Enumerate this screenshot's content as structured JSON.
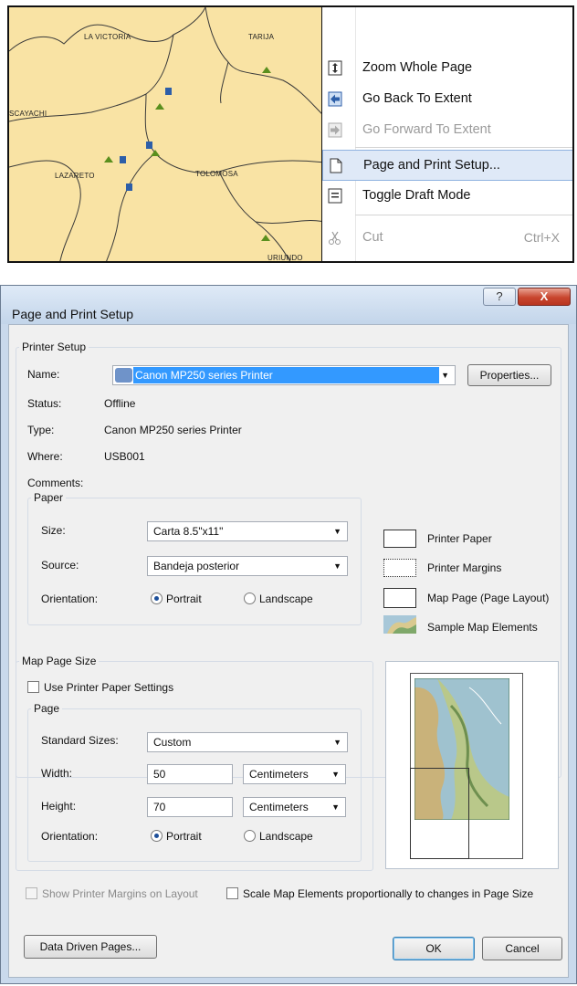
{
  "map": {
    "places": [
      "LA VICTORIA",
      "TARIJA",
      "SCAYACHI",
      "LAZARETO",
      "TOLOMOSA",
      "URIUNDO"
    ],
    "background_color": "#f9e3a4",
    "road_color": "#3a3a3a"
  },
  "context_menu": {
    "items": [
      {
        "label": "Zoom Whole Page",
        "icon": "zoom-whole-page-icon"
      },
      {
        "label": "Go Back To Extent",
        "icon": "go-back-extent-icon"
      },
      {
        "label": "Go Forward To Extent",
        "icon": "go-forward-extent-icon"
      },
      {
        "label": "Page and Print Setup...",
        "icon": "page-print-setup-icon"
      },
      {
        "label": "Toggle Draft Mode",
        "icon": "toggle-draft-icon"
      },
      {
        "label": "Cut",
        "shortcut": "Ctrl+X",
        "icon": "scissors-icon"
      }
    ]
  },
  "dialog": {
    "title": "Page and Print Setup",
    "help_label": "?",
    "close_label": "X",
    "printer_setup": {
      "group_label": "Printer Setup",
      "name_label": "Name:",
      "name_value": "Canon MP250 series Printer",
      "properties_label": "Properties...",
      "status_label": "Status:",
      "status_value": "Offline",
      "type_label": "Type:",
      "type_value": "Canon MP250 series Printer",
      "where_label": "Where:",
      "where_value": "USB001",
      "comments_label": "Comments:"
    },
    "paper": {
      "group_label": "Paper",
      "size_label": "Size:",
      "size_value": "Carta 8.5\"x11\"",
      "source_label": "Source:",
      "source_value": "Bandeja posterior",
      "orientation_label": "Orientation:",
      "portrait_label": "Portrait",
      "landscape_label": "Landscape",
      "orientation_selected": "Portrait"
    },
    "legend": {
      "printer_paper": "Printer Paper",
      "printer_margins": "Printer Margins",
      "map_page": "Map Page (Page Layout)",
      "sample_map_elements": "Sample Map Elements"
    },
    "map_page_size": {
      "group_label": "Map Page Size",
      "use_printer_paper_label": "Use Printer Paper Settings",
      "use_printer_paper_checked": false,
      "page_group_label": "Page",
      "standard_sizes_label": "Standard Sizes:",
      "standard_sizes_value": "Custom",
      "width_label": "Width:",
      "width_value": "50",
      "width_unit": "Centimeters",
      "height_label": "Height:",
      "height_value": "70",
      "height_unit": "Centimeters",
      "orientation_label": "Orientation:",
      "portrait_label": "Portrait",
      "landscape_label": "Landscape",
      "orientation_selected": "Portrait"
    },
    "show_margins_label": "Show Printer Margins on Layout",
    "show_margins_checked": false,
    "scale_elements_label": "Scale Map Elements proportionally to changes in Page Size",
    "scale_elements_checked": false,
    "data_driven_pages_label": "Data Driven Pages...",
    "ok_label": "OK",
    "cancel_label": "Cancel"
  }
}
